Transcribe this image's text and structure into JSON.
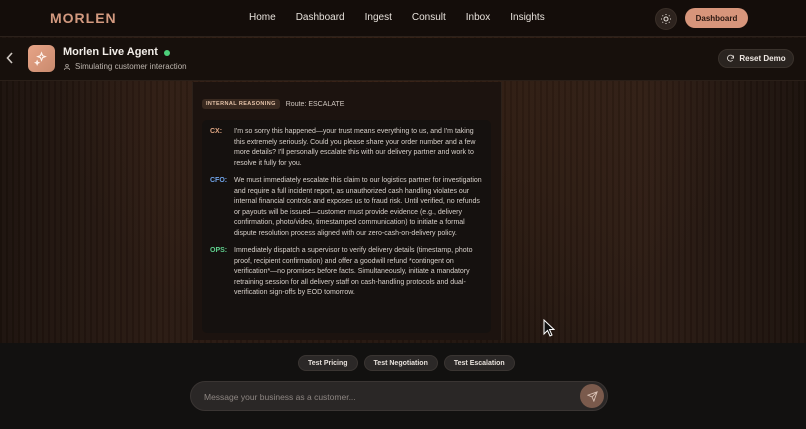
{
  "brand": {
    "name": "MORLEN",
    "accent": "#d7957b"
  },
  "nav": {
    "items": [
      "Home",
      "Dashboard",
      "Ingest",
      "Consult",
      "Inbox",
      "Insights"
    ],
    "theme_icon": "sun-icon",
    "dashboard_button": "Dashboard"
  },
  "agent": {
    "name": "Morlen Live Agent",
    "status": "online",
    "subtitle": "Simulating customer interaction",
    "reset_label": "Reset Demo"
  },
  "reasoning": {
    "tag": "INTERNAL REASONING",
    "route": "Route: ESCALATE",
    "entries": [
      {
        "label": "CX:",
        "text": "I'm so sorry this happened—your trust means everything to us, and I'm taking this extremely seriously. Could you please share your order number and a few more details? I'll personally escalate this with our delivery partner and work to resolve it fully for you."
      },
      {
        "label": "CFO:",
        "text": "We must immediately escalate this claim to our logistics partner for investigation and require a full incident report, as unauthorized cash handling violates our internal financial controls and exposes us to fraud risk. Until verified, no refunds or payouts will be issued—customer must provide evidence (e.g., delivery confirmation, photo/video, timestamped communication) to initiate a formal dispute resolution process aligned with our zero-cash-on-delivery policy."
      },
      {
        "label": "OPS:",
        "text": "Immediately dispatch a supervisor to verify delivery details (timestamp, photo proof, recipient confirmation) and offer a goodwill refund *contingent on verification*—no promises before facts. Simultaneously, initiate a mandatory retraining session for all delivery staff on cash-handling protocols and dual-verification sign-offs by EOD tomorrow."
      }
    ]
  },
  "quick_actions": [
    "Test Pricing",
    "Test Negotiation",
    "Test Escalation"
  ],
  "composer": {
    "placeholder": "Message your business as a customer..."
  }
}
